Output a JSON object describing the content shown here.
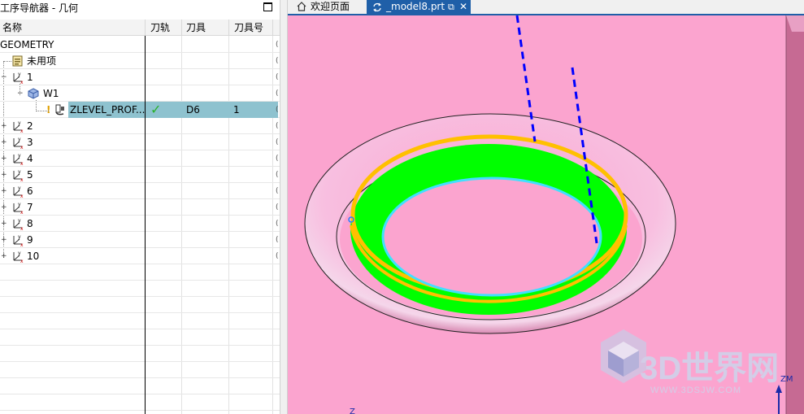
{
  "navigator": {
    "title": "工序导航器 - 几何",
    "columns": [
      "名称",
      "刀轨",
      "刀具",
      "刀具号"
    ],
    "rows": [
      {
        "name": "GEOMETRY"
      },
      {
        "name": "未用项"
      },
      {
        "name": "1"
      },
      {
        "name": "W1"
      },
      {
        "name": "ZLEVEL_PROF...",
        "path": "✓",
        "tool": "D6",
        "tool_no": "1",
        "selected": true
      },
      {
        "name": "2"
      },
      {
        "name": "3"
      },
      {
        "name": "4"
      },
      {
        "name": "5"
      },
      {
        "name": "6"
      },
      {
        "name": "7"
      },
      {
        "name": "8"
      },
      {
        "name": "9"
      },
      {
        "name": "10"
      }
    ],
    "edge_glyph": "("
  },
  "tabs": [
    {
      "label": "欢迎页面",
      "icon": "home-icon"
    },
    {
      "label": "_model8.prt",
      "icon": "sync-icon",
      "active": true
    }
  ],
  "viewport": {
    "watermark_main": "3D世界网",
    "watermark_sub": "WWW.3DSJW.COM",
    "axis_label_zm": "ZM",
    "axis_label_z": "Z",
    "colors": {
      "background": "#fba4cf",
      "band": "#00ff00",
      "rim": "#ffc000",
      "inner": "#40e0ff",
      "toolpath": "#0000ff"
    }
  }
}
